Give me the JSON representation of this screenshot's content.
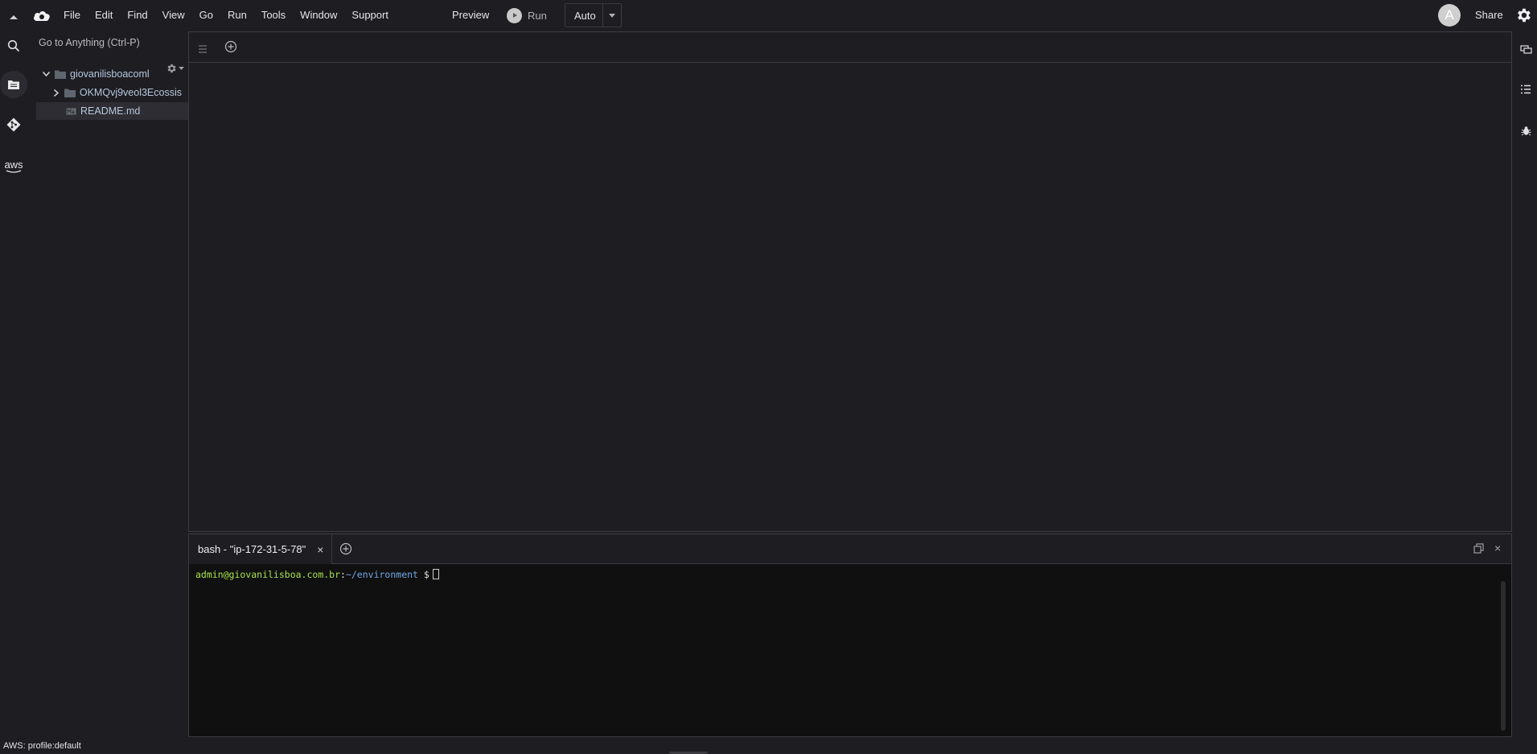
{
  "menubar": {
    "items": [
      "File",
      "Edit",
      "Find",
      "View",
      "Go",
      "Run",
      "Tools",
      "Window",
      "Support"
    ],
    "preview_label": "Preview",
    "run_label": "Run",
    "auto_label": "Auto",
    "avatar_letter": "A",
    "share_label": "Share"
  },
  "rail": {
    "icons": [
      "search-icon",
      "files-icon",
      "git-icon",
      "aws-icon"
    ],
    "aws_text": "aws"
  },
  "tree": {
    "goto_placeholder": "Go to Anything (Ctrl-P)",
    "root_folder": "giovanilisboacoml",
    "sub_folder": "OKMQvj9veol3Ecossis",
    "file": "README.md"
  },
  "terminal": {
    "tab_label": "bash - \"ip-172-31-5-78\"",
    "close_glyph": "×",
    "prompt_user": "admin@giovanilisboa.com.br",
    "prompt_colon": ":",
    "prompt_path": "~/environment",
    "prompt_dollar": "$"
  },
  "right_rail": {
    "icons": [
      "collaborate-icon",
      "outline-icon",
      "debugger-icon"
    ]
  },
  "status": {
    "text": "AWS: profile:default"
  },
  "colors": {
    "background": "#1d1d22",
    "terminal_background": "#101010",
    "prompt_user": "#a7e34a",
    "prompt_path": "#6fa8e8",
    "tree_text": "#b7c7dc"
  }
}
